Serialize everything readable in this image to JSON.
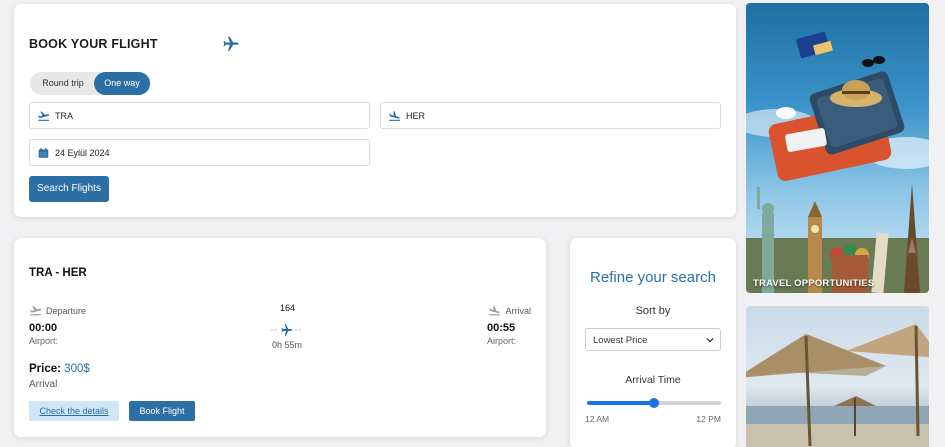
{
  "booking": {
    "title": "BOOK YOUR FLIGHT",
    "trip_types": [
      "Round trip",
      "One way"
    ],
    "selected_trip_type": "One way",
    "from_value": "TRA",
    "to_value": "HER",
    "date_value": "24 Eylül 2024",
    "search_label": "Search Flights"
  },
  "result": {
    "route": "TRA - HER",
    "departure_label": "Departure",
    "arrival_label": "Arrival",
    "departure_time": "00:00",
    "arrival_time": "00:55",
    "departure_airport": "Airport:",
    "arrival_airport": "Airport:",
    "flight_number": "164",
    "duration": "0h 55m",
    "price_label": "Price:",
    "price_value": "300$",
    "arrival_sub": "Arrival",
    "details_label": "Check the details",
    "book_label": "Book Flight"
  },
  "refine": {
    "title": "Refine your search",
    "sort_label": "Sort by",
    "sort_value": "Lowest Price",
    "arrival_time_label": "Arrival Time",
    "slider_min": "12 AM",
    "slider_max": "12 PM",
    "slider_fraction": 0.5
  },
  "promos": {
    "caption_1": "TRAVEL OPPORTUNITIES"
  },
  "colors": {
    "primary": "#2b6fa5",
    "slider": "#1a73e8",
    "details_bg": "#cfe6f7"
  },
  "icons": [
    "plane-icon",
    "takeoff-icon",
    "landing-icon",
    "calendar-icon",
    "chevron-down-icon"
  ]
}
